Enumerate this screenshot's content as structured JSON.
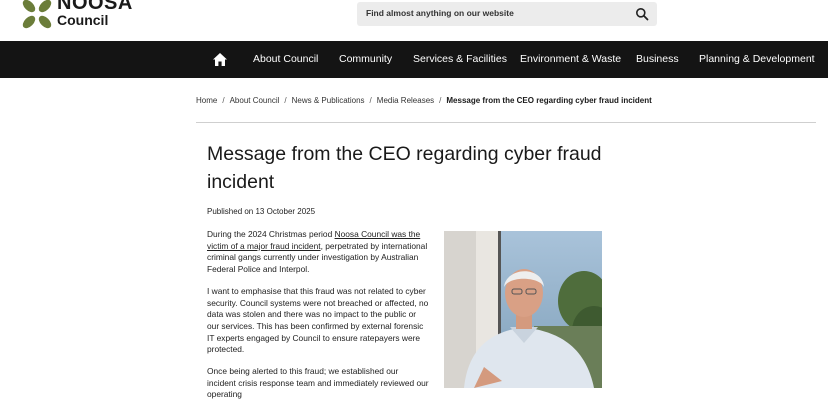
{
  "header": {
    "brand_line1": "NOOSA",
    "brand_line2": "Council",
    "search_placeholder": "Find almost anything on our website"
  },
  "nav": {
    "items": [
      "About Council",
      "Community",
      "Services & Facilities",
      "Environment & Waste",
      "Business",
      "Planning & Development"
    ]
  },
  "breadcrumb": [
    "Home",
    "About Council",
    "News & Publications",
    "Media Releases",
    "Message from the CEO regarding cyber fraud incident"
  ],
  "article": {
    "title": "Message from the CEO regarding cyber fraud incident",
    "published": "Published on 13 October 2025",
    "p1_before": "During the 2024 Christmas period ",
    "p1_link": "Noosa Council was the victim of a major fraud incident",
    "p1_after": ", perpetrated by international criminal gangs currently under investigation by Australian Federal Police and Interpol.",
    "p2": "I want to emphasise that this fraud was not related to cyber security. Council systems were not breached or affected, no data was stolen and there was no impact to the public or our services. This has been confirmed by external forensic IT experts engaged by Council to ensure ratepayers were protected.",
    "p3": "Once being alerted to this fraud; we established our incident crisis response team and immediately reviewed our operating"
  },
  "colors": {
    "nav_bg": "#141414",
    "logo_green": "#6b7d3a",
    "search_bg": "#ececec"
  }
}
